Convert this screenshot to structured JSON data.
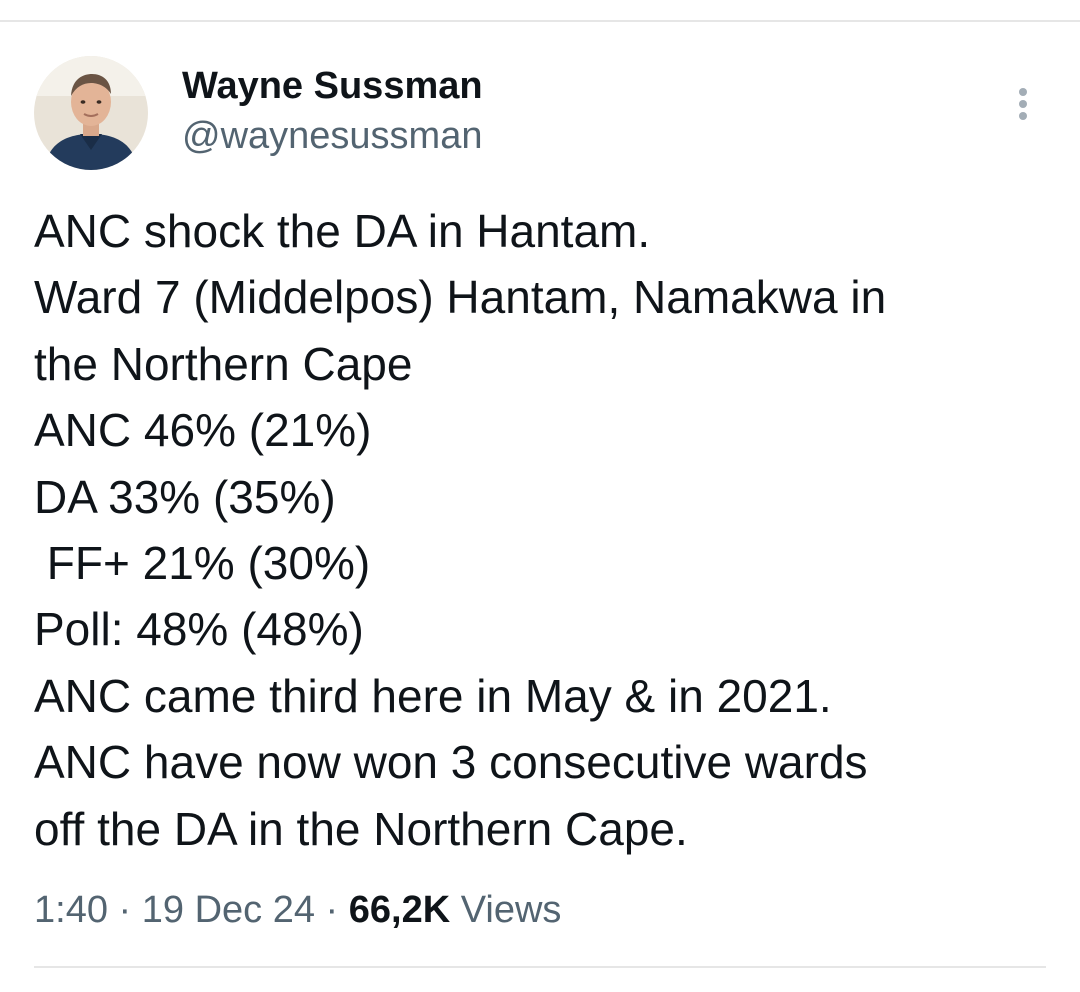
{
  "author": {
    "display_name": "Wayne Sussman",
    "handle": "@waynesussman",
    "avatar_icon": "profile-photo-avatar"
  },
  "more_icon": "more-options-vertical-icon",
  "tweet": {
    "lines": [
      "ANC shock the DA in Hantam.",
      "Ward 7 (Middelpos) Hantam, Namakwa in",
      "the Northern Cape",
      "ANC 46% (21%)",
      "DA 33% (35%)",
      " FF+ 21% (30%)",
      "Poll: 48% (48%)",
      "ANC came third here in May & in 2021.",
      "ANC have now won 3 consecutive wards",
      "off the DA in the Northern Cape."
    ]
  },
  "meta": {
    "time": "1:40",
    "separator": "·",
    "date": "19 Dec 24",
    "views_count": "66,2K",
    "views_label": "Views"
  },
  "colors": {
    "text_primary": "#0f1419",
    "text_secondary": "#536471",
    "divider": "#e6e6e6"
  }
}
